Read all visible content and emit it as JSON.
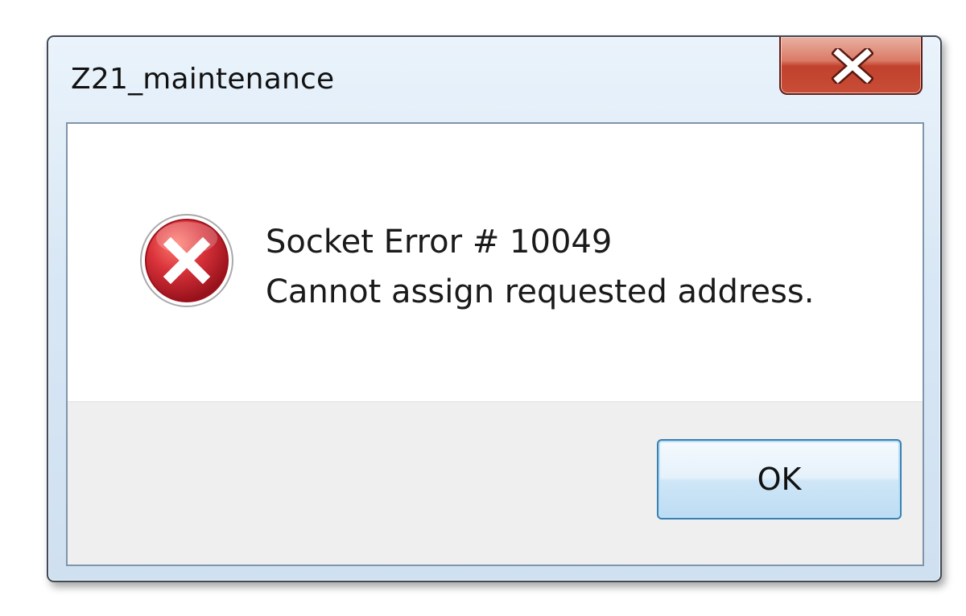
{
  "window": {
    "title": "Z21_maintenance"
  },
  "message": {
    "line1": "Socket Error # 10049",
    "line2": "Cannot assign requested address."
  },
  "buttons": {
    "ok_label": "OK"
  },
  "icons": {
    "close": "close-icon",
    "error": "error-icon"
  },
  "colors": {
    "close_button": "#c84d36",
    "error_icon": "#c8202a",
    "ok_border": "#3c7fb1"
  }
}
